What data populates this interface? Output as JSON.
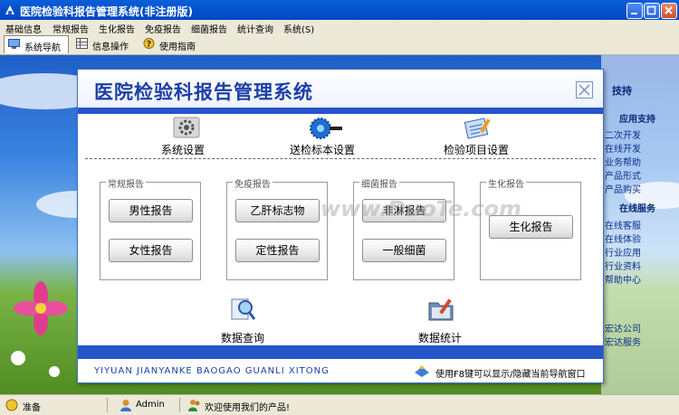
{
  "window": {
    "title": "医院检验科报告管理系统(非注册版)"
  },
  "menu": [
    "基础信息",
    "常规报告",
    "生化报告",
    "免疫报告",
    "细菌报告",
    "统计查询",
    "系统(S)"
  ],
  "toolbar": {
    "items": [
      {
        "label": "系统导航",
        "icon": "monitor-icon"
      },
      {
        "label": "信息操作",
        "icon": "grid-icon"
      },
      {
        "label": "使用指南",
        "icon": "help-icon"
      }
    ]
  },
  "right_panel": {
    "items": [
      {
        "text": "技持",
        "heading": true
      },
      {
        "text": "应用支持",
        "heading": true
      },
      {
        "text": "二次开发",
        "heading": false
      },
      {
        "text": "在线开发",
        "heading": false
      },
      {
        "text": "业务帮助",
        "heading": false
      },
      {
        "text": "产品形式",
        "heading": false
      },
      {
        "text": "产品购买",
        "heading": false
      },
      {
        "text": "在线服务",
        "heading": true
      },
      {
        "text": "在线客服",
        "heading": false
      },
      {
        "text": "在线体验",
        "heading": false
      },
      {
        "text": "行业应用",
        "heading": false
      },
      {
        "text": "行业资料",
        "heading": false
      },
      {
        "text": "帮助中心",
        "heading": false
      },
      {
        "text": "宏达公司",
        "heading": false
      },
      {
        "text": "宏达服务",
        "heading": false
      }
    ]
  },
  "dialog": {
    "title": "医院检验科报告管理系统",
    "top_items": [
      {
        "label": "系统设置",
        "icon": "gear-icon"
      },
      {
        "label": "送检标本设置",
        "icon": "saw-blade-icon"
      },
      {
        "label": "检验项目设置",
        "icon": "notepad-icon"
      }
    ],
    "groups": [
      {
        "label": "常规报告",
        "buttons": [
          "男性报告",
          "女性报告"
        ]
      },
      {
        "label": "免疫报告",
        "buttons": [
          "乙肝标志物",
          "定性报告"
        ]
      },
      {
        "label": "细菌报告",
        "buttons": [
          "非淋报告",
          "一般细菌"
        ]
      },
      {
        "label": "生化报告",
        "buttons": [
          "生化报告"
        ]
      }
    ],
    "bottom_items": [
      {
        "label": "数据查询",
        "icon": "magnifier-icon"
      },
      {
        "label": "数据统计",
        "icon": "folder-pen-icon"
      }
    ],
    "footer_pinyin": "YIYUAN JIANYANKE BAOGAO GUANLI XITONG",
    "footer_hint": "使用F8键可以显示/隐藏当前导航窗口"
  },
  "watermark": "www.DuoTe.com",
  "statusbar": {
    "status": "准备",
    "user": "Admin",
    "welcome": "欢迎使用我们的产品!"
  },
  "colors": {
    "title_blue": "#1d3ea7",
    "bar_blue": "#2654c9",
    "xp_title": "#0554d0"
  }
}
